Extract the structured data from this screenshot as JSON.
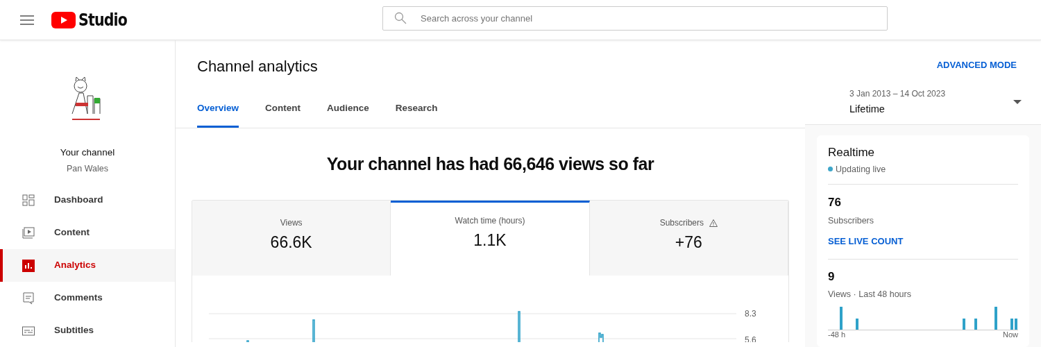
{
  "header": {
    "logo_text": "Studio",
    "search": {
      "placeholder": "Search across your channel"
    }
  },
  "sidebar": {
    "channel_title": "Your channel",
    "channel_name": "Pan Wales",
    "items": [
      {
        "label": "Dashboard",
        "kind": "dashboard",
        "selected": false
      },
      {
        "label": "Content",
        "kind": "content",
        "selected": false
      },
      {
        "label": "Analytics",
        "kind": "analytics",
        "selected": true
      },
      {
        "label": "Comments",
        "kind": "comments",
        "selected": false
      },
      {
        "label": "Subtitles",
        "kind": "subtitles",
        "selected": false
      }
    ]
  },
  "page": {
    "title": "Channel analytics",
    "advanced_link": "ADVANCED MODE",
    "tabs": [
      {
        "label": "Overview",
        "selected": true
      },
      {
        "label": "Content",
        "selected": false
      },
      {
        "label": "Audience",
        "selected": false
      },
      {
        "label": "Research",
        "selected": false
      }
    ],
    "date_range": {
      "range": "3 Jan 2013 – 14 Oct 2023",
      "label": "Lifetime"
    }
  },
  "summary": {
    "headline": "Your channel has had 66,646 views so far",
    "metrics": [
      {
        "label": "Views",
        "value": "66.6K",
        "selected": false,
        "warning": false
      },
      {
        "label": "Watch time (hours)",
        "value": "1.1K",
        "selected": true,
        "warning": false
      },
      {
        "label": "Subscribers",
        "value": "+76",
        "selected": false,
        "warning": true
      }
    ],
    "chart_ticks": [
      "8.3",
      "5.6"
    ]
  },
  "realtime": {
    "title": "Realtime",
    "status": "Updating live",
    "subscribers": {
      "value": "76",
      "label": "Subscribers",
      "link": "SEE LIVE COUNT"
    },
    "views": {
      "value": "9",
      "label": "Views · Last 48 hours",
      "axis_start": "-48 h",
      "axis_end": "Now"
    }
  }
}
